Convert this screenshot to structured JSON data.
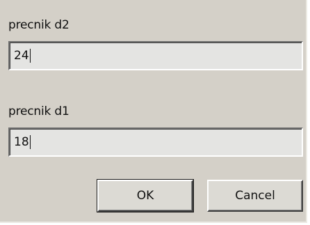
{
  "dialog": {
    "fields": [
      {
        "label": "precnik d2",
        "value": "24"
      },
      {
        "label": "precnik d1",
        "value": "18"
      }
    ],
    "buttons": {
      "ok_label": "OK",
      "cancel_label": "Cancel"
    }
  }
}
